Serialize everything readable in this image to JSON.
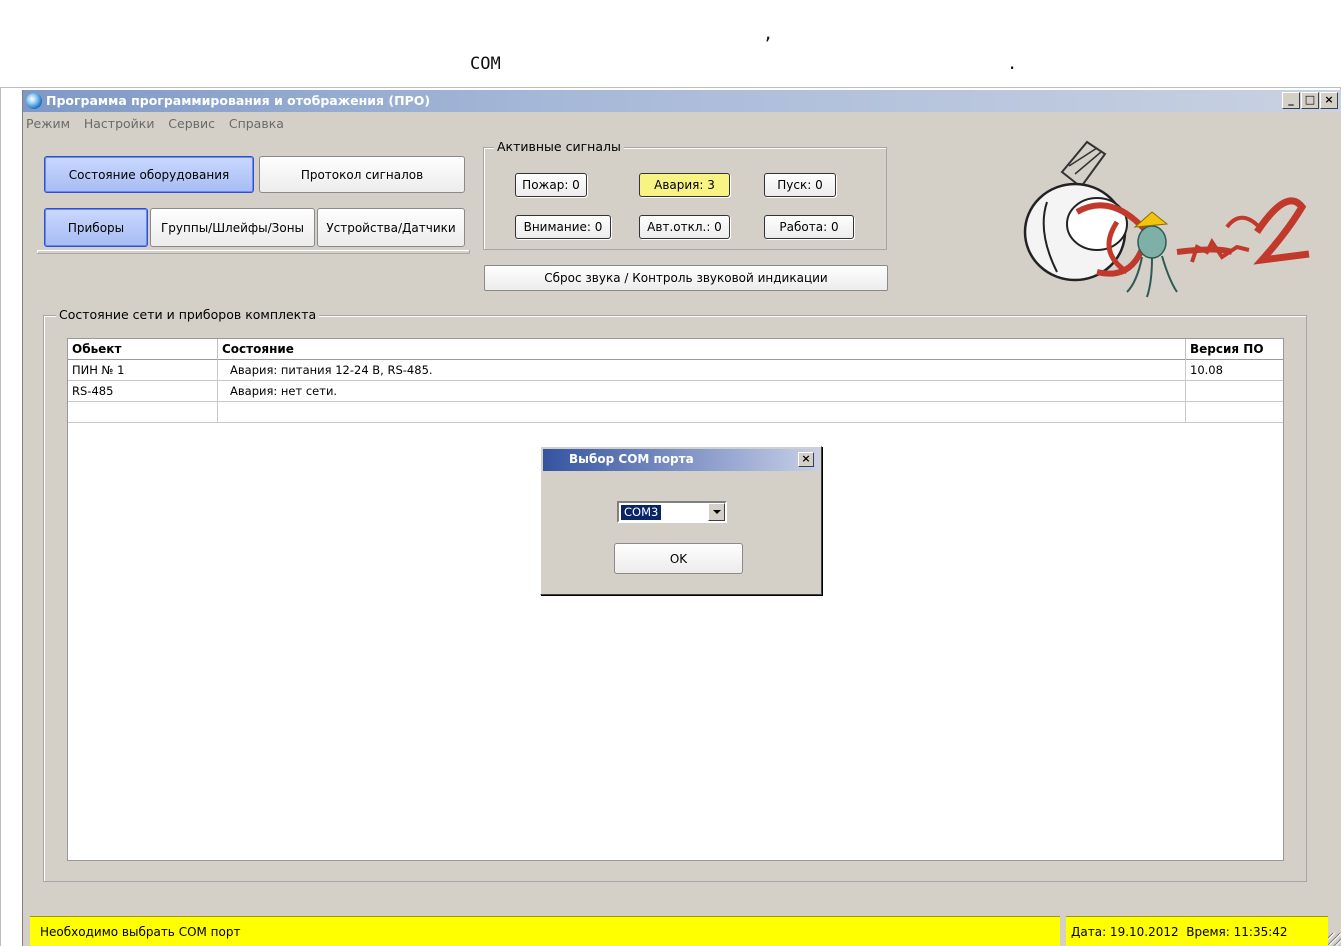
{
  "caption": {
    "line1": ",",
    "line2_left": "COM",
    "line2_right": "."
  },
  "window": {
    "title": "Программа программирования и отображения (ПРО)",
    "controls": {
      "minimize": "_",
      "maximize": "□",
      "close": "×"
    }
  },
  "menu": [
    "Режим",
    "Настройки",
    "Сервис",
    "Справка"
  ],
  "nav": {
    "state_button": "Состояние оборудования",
    "protocol_button": "Протокол сигналов",
    "devices_tab": "Приборы",
    "groups_tab": "Группы/Шлейфы/Зоны",
    "sensors_tab": "Устройства/Датчики"
  },
  "signals": {
    "legend": "Активные сигналы",
    "fire": "Пожар: 0",
    "alarm": "Авария: 3",
    "start": "Пуск: 0",
    "attention": "Внимание: 0",
    "auto_off": "Авт.откл.: 0",
    "work": "Работа: 0",
    "reset_button": "Сброс звука / Контроль звуковой индикации"
  },
  "logo": {
    "text": "Спрут-2"
  },
  "network": {
    "legend": "Состояние сети и приборов комплекта",
    "columns": [
      "Обьект",
      "Состояние",
      "Версия ПО"
    ],
    "rows": [
      {
        "object": "ПИН № 1",
        "state": "Авария: питания 12-24 В, RS-485.",
        "version": "10.08"
      },
      {
        "object": "RS-485",
        "state": "Авария: нет сети.",
        "version": ""
      },
      {
        "object": "",
        "state": "",
        "version": ""
      }
    ]
  },
  "dialog": {
    "title": "Выбор COM порта",
    "close": "×",
    "selected_port": "COM3",
    "ok": "OK"
  },
  "status": {
    "message": "Необходимо выбрать COM порт",
    "datetime": "Дата: 19.10.2012  Время: 11:35:42"
  },
  "colors": {
    "status_bar": "#ffff00",
    "alarm_button": "#f8f484",
    "active_button": "#a7bcf2",
    "window_bg": "#d4d0c8"
  }
}
